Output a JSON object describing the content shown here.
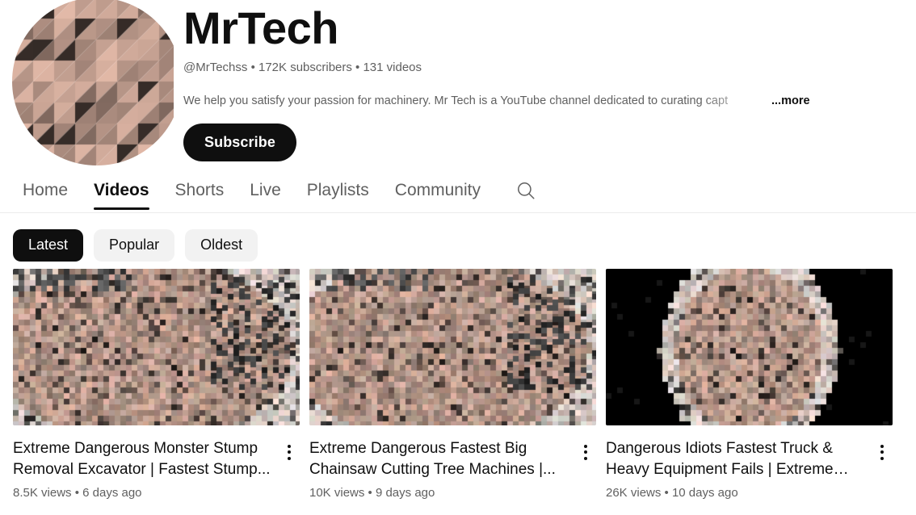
{
  "channel": {
    "name": "MrTech",
    "handle": "@MrTechss",
    "subscribers": "172K subscribers",
    "videos_count": "131 videos",
    "meta_line": "@MrTechss • 172K subscribers • 131 videos",
    "description": "We help you satisfy your passion for machinery. Mr Tech is a YouTube channel dedicated to curating capt",
    "more_label": "...more",
    "subscribe_label": "Subscribe",
    "avatar_alt": "channel-avatar"
  },
  "tabs": [
    {
      "label": "Home",
      "active": false
    },
    {
      "label": "Videos",
      "active": true
    },
    {
      "label": "Shorts",
      "active": false
    },
    {
      "label": "Live",
      "active": false
    },
    {
      "label": "Playlists",
      "active": false
    },
    {
      "label": "Community",
      "active": false
    }
  ],
  "search": {
    "icon": "search-icon"
  },
  "chips": [
    {
      "label": "Latest",
      "active": true
    },
    {
      "label": "Popular",
      "active": false
    },
    {
      "label": "Oldest",
      "active": false
    }
  ],
  "videos": [
    {
      "title": "Extreme Dangerous Monster Stump Removal Excavator | Fastest Stump...",
      "views": "8.5K views",
      "age": "6 days ago",
      "stats": "8.5K views • 6 days ago",
      "thumb_style": "pixelated-light",
      "menu_icon": "kebab-menu-icon"
    },
    {
      "title": "Extreme Dangerous Fastest Big Chainsaw Cutting Tree Machines |...",
      "views": "10K views",
      "age": "9 days ago",
      "stats": "10K views • 9 days ago",
      "thumb_style": "pixelated-light",
      "menu_icon": "kebab-menu-icon"
    },
    {
      "title": "Dangerous Idiots Fastest Truck & Heavy Equipment Fails | Extreme Truc...",
      "views": "26K views",
      "age": "10 days ago",
      "stats": "26K views • 10 days ago",
      "thumb_style": "pixelated-letterbox",
      "menu_icon": "kebab-menu-icon"
    }
  ],
  "colors": {
    "text_primary": "#0f0f0f",
    "text_secondary": "#606060",
    "chip_bg": "#f2f2f2",
    "chip_active_bg": "#0f0f0f",
    "divider": "#ececec",
    "page_bg": "#ffffff"
  }
}
